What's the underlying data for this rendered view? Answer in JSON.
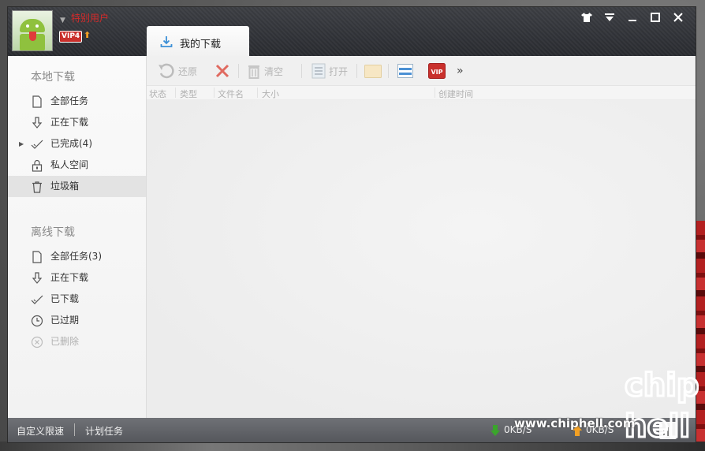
{
  "user": {
    "name": "特别用户",
    "vip_badge": "VIP4"
  },
  "tabs": [
    {
      "label": "我的下载"
    }
  ],
  "window_controls": [
    "skin-icon",
    "menu-icon",
    "minimize-icon",
    "maximize-icon",
    "close-icon"
  ],
  "sidebar": {
    "local_title": "本地下载",
    "local_items": [
      {
        "label": "全部任务",
        "icon": "file-icon"
      },
      {
        "label": "正在下载",
        "icon": "download-arrow-icon"
      },
      {
        "label": "已完成(4)",
        "icon": "check-icon"
      },
      {
        "label": "私人空间",
        "icon": "lock-icon"
      },
      {
        "label": "垃圾箱",
        "icon": "trash-icon",
        "selected": true
      }
    ],
    "offline_title": "离线下载",
    "offline_items": [
      {
        "label": "全部任务(3)",
        "icon": "file-icon"
      },
      {
        "label": "正在下载",
        "icon": "download-arrow-icon"
      },
      {
        "label": "已下载",
        "icon": "check-icon"
      },
      {
        "label": "已过期",
        "icon": "clock-icon"
      },
      {
        "label": "已删除",
        "icon": "x-circle-icon"
      }
    ]
  },
  "toolbar": {
    "restore": "还原",
    "clear": "清空",
    "open": "打开",
    "more": "»"
  },
  "columns": {
    "status": "状态",
    "type": "类型",
    "filename": "文件名",
    "size": "大小",
    "created": "创建时间"
  },
  "statusbar": {
    "custom_speed": "自定义限速",
    "schedule": "计划任务",
    "download_speed": "0KB/S",
    "upload_speed": "0KB/S"
  },
  "watermark": {
    "site": "www.chiphell.com",
    "logo_top": "chip",
    "logo_bottom": "hell"
  },
  "colors": {
    "accent_red": "#c9302c",
    "download_green": "#3aa52b",
    "upload_orange": "#f2a024"
  }
}
